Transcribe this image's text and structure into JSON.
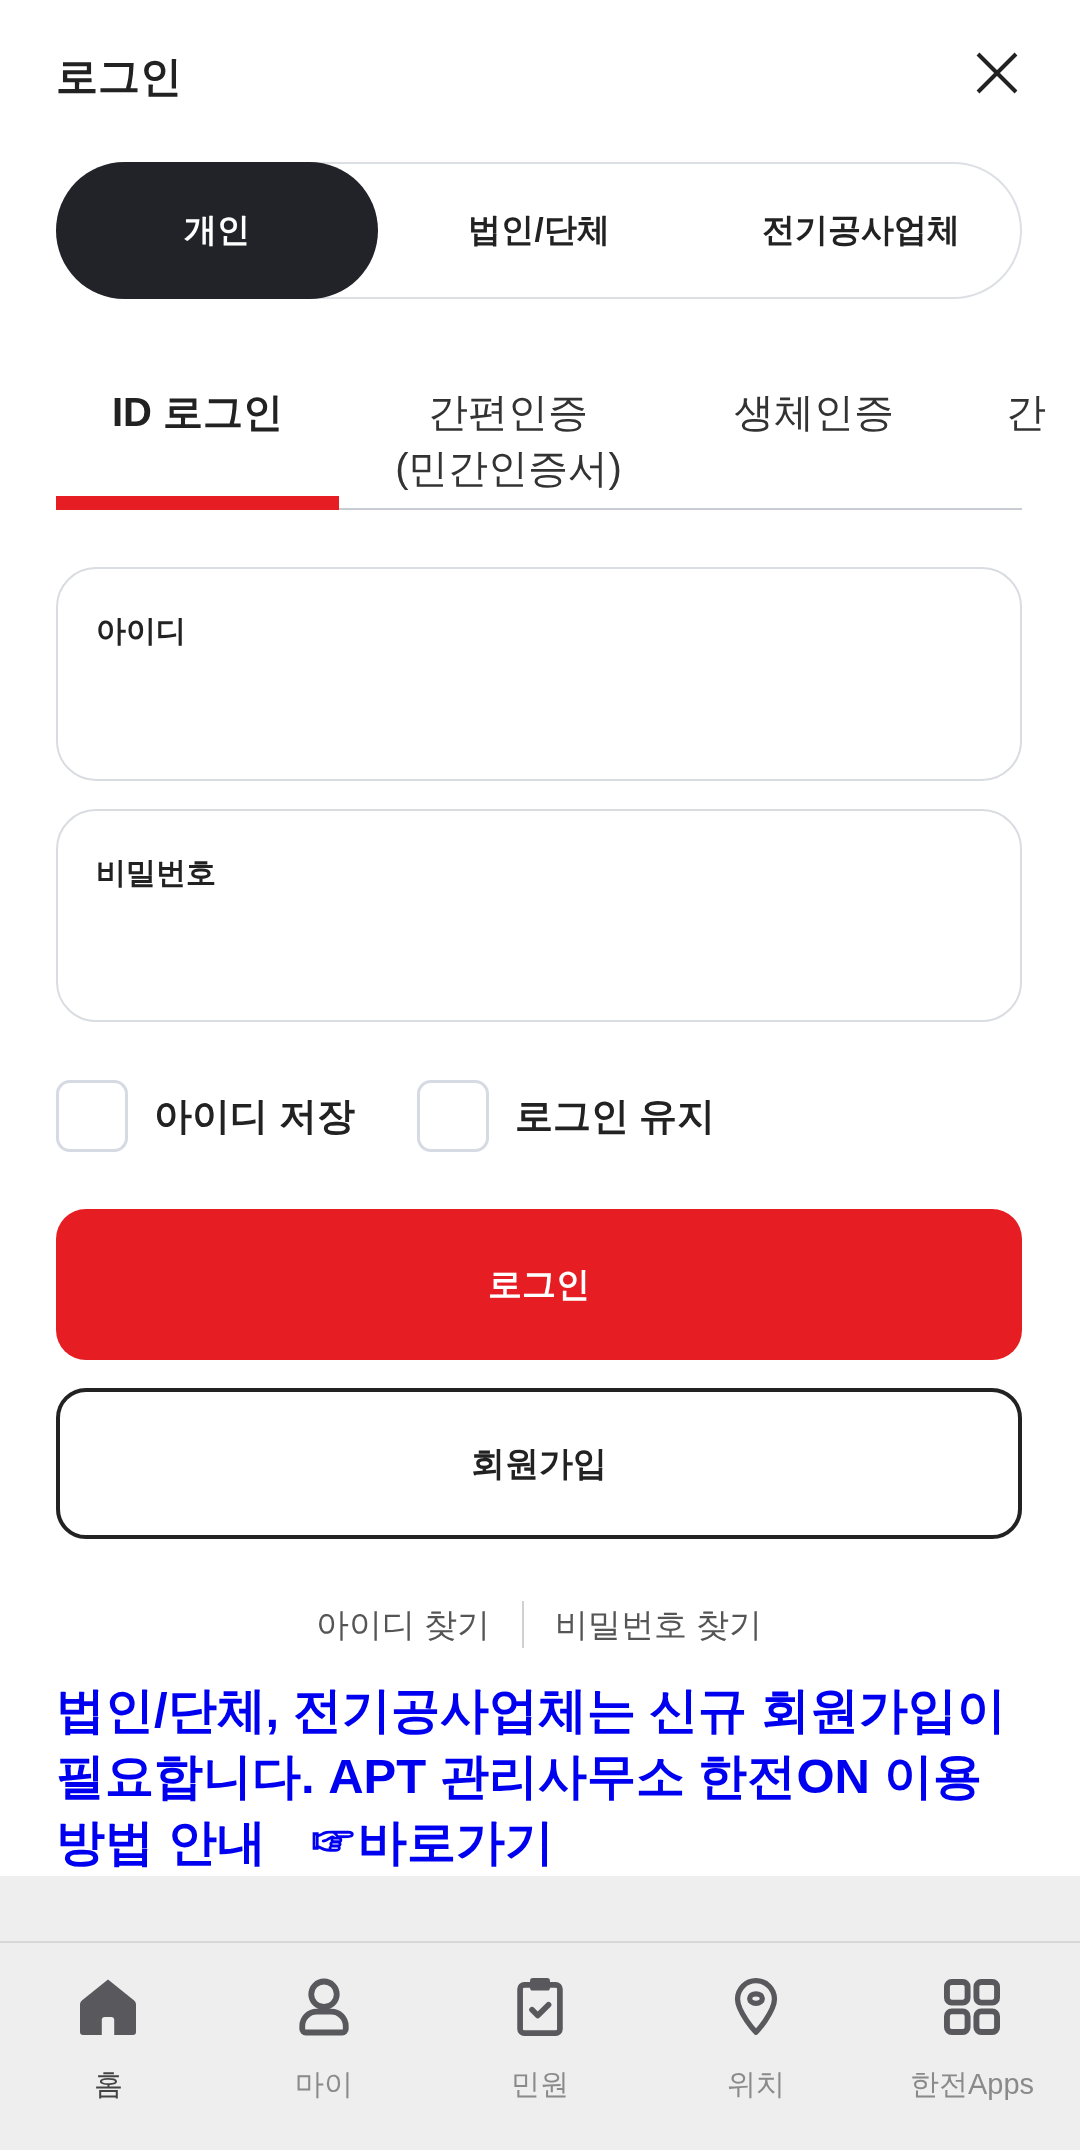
{
  "header": {
    "title": "로그인"
  },
  "member_types": [
    {
      "label": "개인",
      "selected": true
    },
    {
      "label": "법인/단체",
      "selected": false
    },
    {
      "label": "전기공사업체",
      "selected": false
    }
  ],
  "login_methods": [
    {
      "label": "ID 로그인",
      "selected": true
    },
    {
      "label": "간편인증\n(민간인증서)",
      "selected": false
    },
    {
      "label": "생체인증",
      "selected": false
    },
    {
      "label": "간",
      "selected": false
    }
  ],
  "fields": [
    {
      "label": "아이디"
    },
    {
      "label": "비밀번호"
    }
  ],
  "options": [
    {
      "label": "아이디 저장",
      "checked": false
    },
    {
      "label": "로그인 유지",
      "checked": false
    }
  ],
  "buttons": [
    {
      "label": "로그인",
      "kind": "primary"
    },
    {
      "label": "회원가입",
      "kind": "outline"
    }
  ],
  "links": [
    "아이디 찾기",
    "비밀번호 찾기"
  ],
  "notice": {
    "text": "법인/단체, 전기공사업체는 신규 회원가입이 필요합니다. APT 관리사무소 한전ON 이용방법 안내",
    "link": "☞바로가기"
  },
  "bottom_nav": [
    {
      "label": "홈",
      "selected": true
    },
    {
      "label": "마이",
      "selected": false
    },
    {
      "label": "민원",
      "selected": false
    },
    {
      "label": "위치",
      "selected": false
    },
    {
      "label": "한전Apps",
      "selected": false
    }
  ]
}
